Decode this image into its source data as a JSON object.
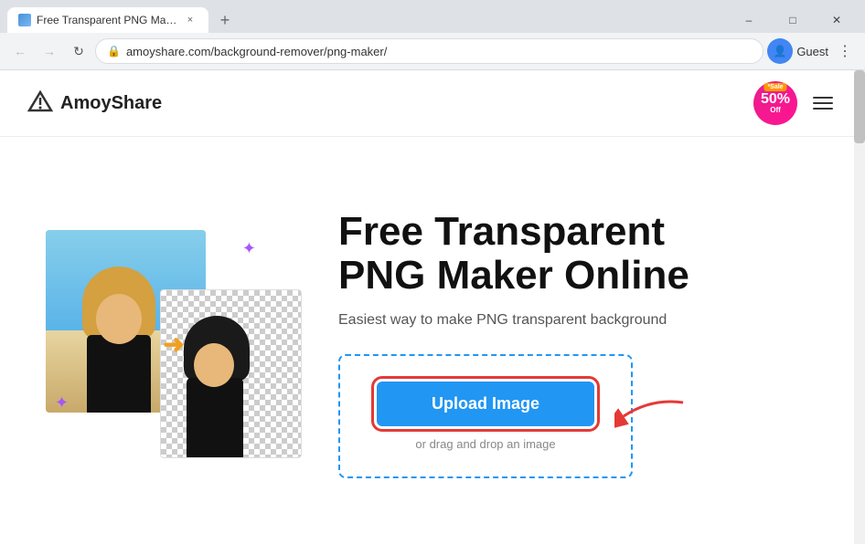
{
  "browser": {
    "tab": {
      "title": "Free Transparent PNG Maker -",
      "close_label": "×"
    },
    "new_tab_label": "+",
    "window_controls": {
      "minimize": "–",
      "maximize": "□",
      "close": "✕"
    },
    "nav": {
      "back_label": "←",
      "forward_label": "→",
      "reload_label": "↻",
      "url": "amoyshare.com/background-remover/png-maker/",
      "profile_label": "Guest",
      "menu_label": "⋮"
    }
  },
  "site": {
    "logo_text": "AmoyShare",
    "sale_badge": {
      "sale": "*Sale",
      "percent": "50%",
      "off": "Off"
    }
  },
  "hero": {
    "title_line1": "Free Transparent",
    "title_line2": "PNG Maker Online",
    "subtitle": "Easiest way to make PNG transparent background",
    "upload_btn_label": "Upload Image",
    "upload_hint": "or drag and drop an image"
  }
}
